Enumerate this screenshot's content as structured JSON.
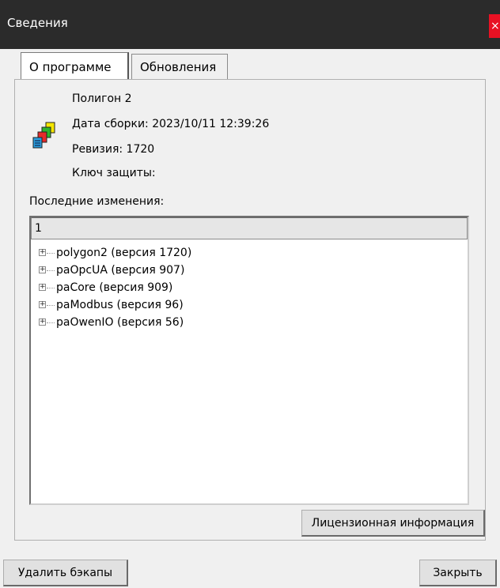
{
  "window": {
    "title": "Сведения",
    "close_glyph": "×"
  },
  "tabs": [
    {
      "label": "О программе",
      "active": true
    },
    {
      "label": "Обновления",
      "active": false
    }
  ],
  "about": {
    "product": "Полигон 2",
    "build_date": "Дата сборки: 2023/10/11 12:39:26",
    "revision": "Ревизия: 1720",
    "protection_key": "Ключ защиты:"
  },
  "changes": {
    "label": "Последние изменения:",
    "header": "1",
    "items": [
      "polygon2 (версия 1720)",
      "paOpcUA (версия 907)",
      "paCore (версия 909)",
      "paModbus (версия 96)",
      "paOwenIO (версия 56)"
    ]
  },
  "buttons": {
    "license": "Лицензионная информация",
    "delete_backups": "Удалить бэкапы",
    "close": "Закрыть"
  },
  "icons": {
    "app": "colored-documents-stack-icon",
    "expander": "plus-box-icon"
  },
  "colors": {
    "titlebar": "#2b2b2b",
    "close": "#e81123",
    "window_bg": "#f0f0f0"
  }
}
